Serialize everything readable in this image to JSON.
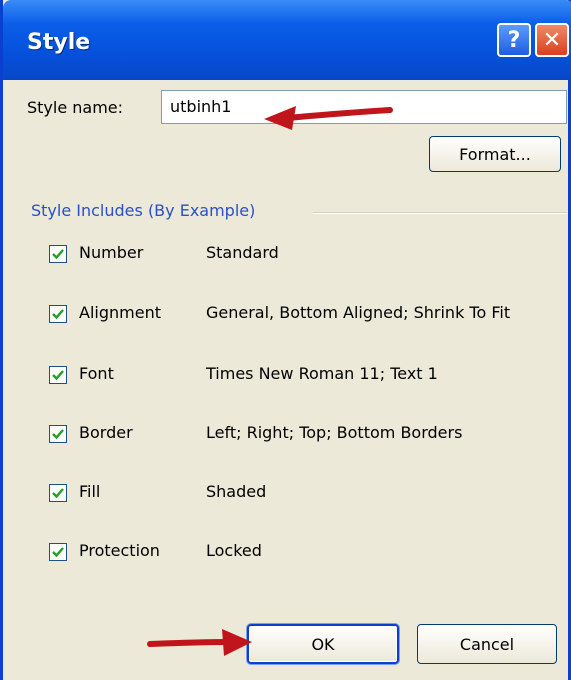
{
  "dialog": {
    "title": "Style",
    "help_label": "?",
    "close_label": "✕"
  },
  "style_name": {
    "label": "Style name:",
    "value": "utbinh1"
  },
  "format_button": "Format...",
  "group": {
    "label": "Style Includes (By Example)",
    "items": [
      {
        "label": "Number",
        "value": "Standard",
        "checked": true
      },
      {
        "label": "Alignment",
        "value": "General, Bottom Aligned; Shrink To Fit",
        "checked": true
      },
      {
        "label": "Font",
        "value": "Times New Roman 11; Text 1",
        "checked": true
      },
      {
        "label": "Border",
        "value": "Left; Right; Top; Bottom Borders",
        "checked": true
      },
      {
        "label": "Fill",
        "value": "Shaded",
        "checked": true
      },
      {
        "label": "Protection",
        "value": "Locked",
        "checked": true
      }
    ]
  },
  "ok_button": "OK",
  "cancel_button": "Cancel",
  "colors": {
    "titlebar": "#0a5ee8",
    "annotation_arrow": "#c0151a"
  }
}
